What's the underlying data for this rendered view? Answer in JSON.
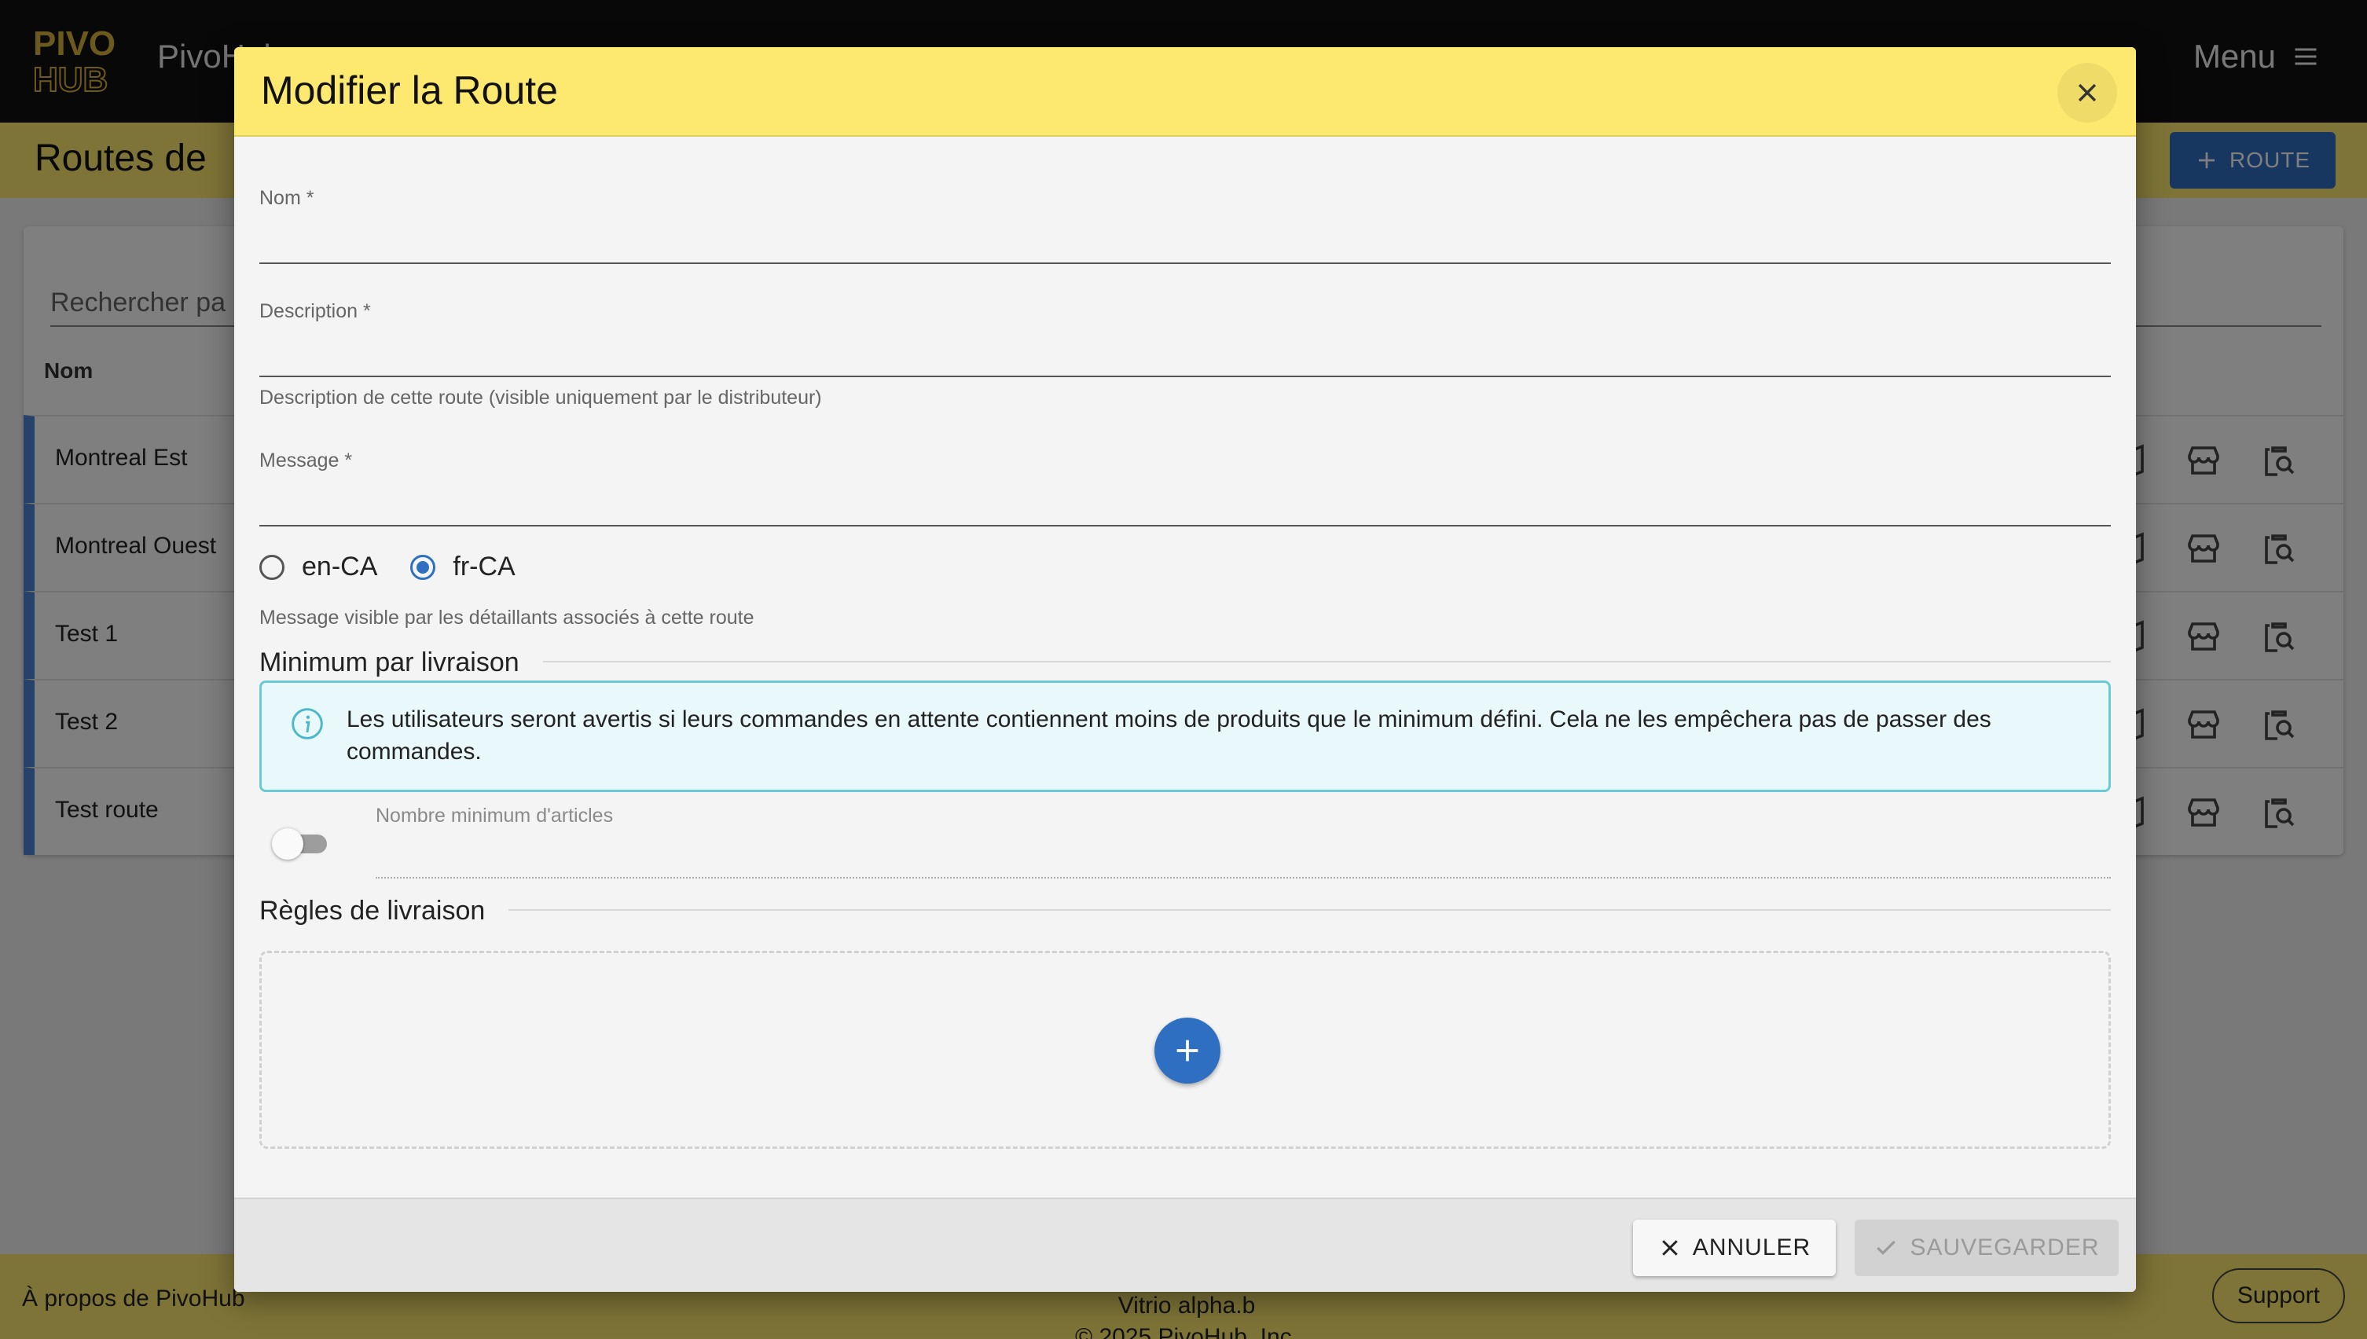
{
  "app": {
    "logo_text": "PivoHub",
    "menu_label": "Menu"
  },
  "page": {
    "title": "Routes de",
    "add_route_label": "ROUTE",
    "search_placeholder": "Rechercher pa",
    "column_name": "Nom",
    "rows": [
      {
        "name": "Montreal Est"
      },
      {
        "name": "Montreal Ouest"
      },
      {
        "name": "Test 1"
      },
      {
        "name": "Test 2"
      },
      {
        "name": "Test route"
      }
    ]
  },
  "footer": {
    "about": "À propos de PivoHub",
    "version": "Vitrio alpha.b",
    "copyright": "© 2025 PivoHub, Inc.",
    "support": "Support"
  },
  "dialog": {
    "title": "Modifier la Route",
    "name_label": "Nom *",
    "name_value": "",
    "description_label": "Description *",
    "description_value": "",
    "description_helper": "Description de cette route (visible uniquement par le distributeur)",
    "message_label": "Message *",
    "message_value": "",
    "lang_options": [
      {
        "label": "en-CA",
        "checked": false
      },
      {
        "label": "fr-CA",
        "checked": true
      }
    ],
    "message_helper": "Message visible par les détaillants associés à cette route",
    "min_section_title": "Minimum par livraison",
    "info_text": "Les utilisateurs seront avertis si leurs commandes en attente contiennent moins de produits que le minimum défini. Cela ne les empêchera pas de passer des commandes.",
    "min_toggle_on": false,
    "min_label": "Nombre minimum d'articles",
    "min_value": "",
    "rules_section_title": "Règles de livraison",
    "cancel_label": "ANNULER",
    "save_label": "SAUVEGARDER"
  },
  "colors": {
    "brand_yellow": "#fde96f",
    "primary_blue": "#2f6fc2",
    "info_border": "#6cc9d6"
  }
}
